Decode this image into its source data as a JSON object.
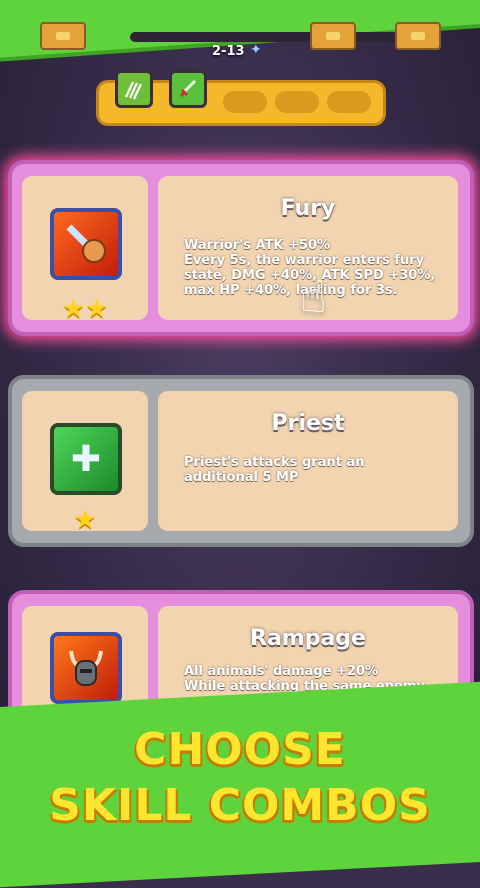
{
  "hud": {
    "stage": "2-13",
    "wing_icon": "wing-icon"
  },
  "skill_slots": {
    "icons": [
      "claw-icon",
      "sword-icon"
    ]
  },
  "cards": [
    {
      "name": "Fury",
      "description_lines": [
        "Warrior's ATK +50%",
        "Every 5s, the warrior enters fury",
        "state, DMG +40%, ATK SPD +30%,",
        "max HP +40%, lasting for 3s."
      ],
      "stars": "★★",
      "icon": "fist-sword-icon"
    },
    {
      "name": "Priest",
      "description_lines": [
        "Priest's attacks grant an",
        "additional 5 MP"
      ],
      "stars": "★",
      "icon": "cross-icon"
    },
    {
      "name": "Rampage",
      "description_lines": [
        "All animals' damage +20%",
        "While attacking the same enemy..."
      ],
      "icon": "horned-helmet-icon"
    }
  ],
  "banner": {
    "line1": "CHOOSE",
    "line2": "SKILL COMBOS"
  },
  "colors": {
    "banner_green": "#5fd33c",
    "headline_yellow": "#ffe62e",
    "card_pink": "#e58ede",
    "card_gray": "#a6a9ad"
  }
}
